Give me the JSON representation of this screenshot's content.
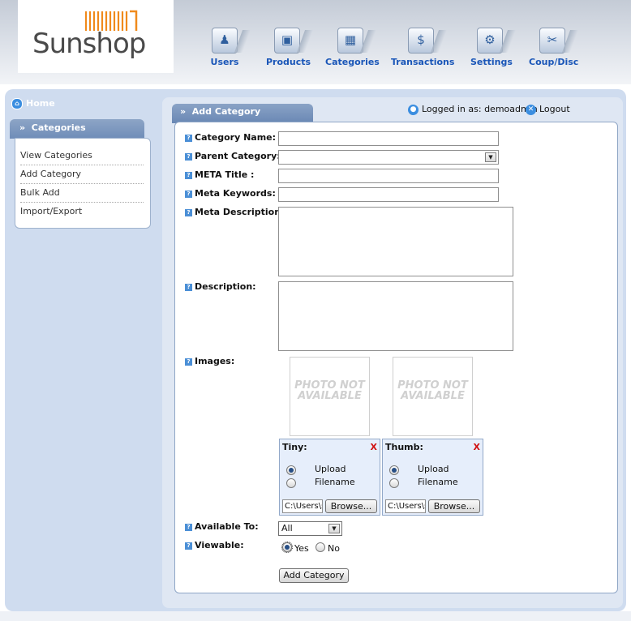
{
  "logo": {
    "text": "Sunshop"
  },
  "nav": [
    {
      "label": "Users",
      "icon": "users-icon"
    },
    {
      "label": "Products",
      "icon": "products-icon"
    },
    {
      "label": "Categories",
      "icon": "categories-icon"
    },
    {
      "label": "Transactions",
      "icon": "transactions-icon"
    },
    {
      "label": "Settings",
      "icon": "settings-icon"
    },
    {
      "label": "Coup/Disc",
      "icon": "coupon-icon"
    }
  ],
  "sidebar": {
    "home": "Home",
    "section": "Categories",
    "items": [
      "View Categories",
      "Add Category",
      "Bulk Add",
      "Import/Export"
    ]
  },
  "content": {
    "tab": "Add Category",
    "logged_in": "Logged in as: demoadmin",
    "logout": "Logout"
  },
  "form": {
    "category_name": {
      "label": "Category Name:",
      "value": ""
    },
    "parent_category": {
      "label": "Parent Category:",
      "value": ""
    },
    "meta_title": {
      "label": "META Title :",
      "value": ""
    },
    "meta_keywords": {
      "label": "Meta Keywords:",
      "value": ""
    },
    "meta_description": {
      "label": "Meta Description:",
      "value": ""
    },
    "description": {
      "label": "Description:",
      "value": ""
    },
    "images": {
      "label": "Images:",
      "placeholder": "PHOTO NOT AVAILABLE",
      "tiny": {
        "title": "Tiny:",
        "remove": "X",
        "upload": "Upload",
        "filename": "Filename",
        "path": "C:\\Users\\s",
        "browse": "Browse...",
        "selected": "upload"
      },
      "thumb": {
        "title": "Thumb:",
        "remove": "X",
        "upload": "Upload",
        "filename": "Filename",
        "path": "C:\\Users\\s",
        "browse": "Browse...",
        "selected": "upload"
      }
    },
    "available_to": {
      "label": "Available To:",
      "value": "All"
    },
    "viewable": {
      "label": "Viewable:",
      "yes": "Yes",
      "no": "No",
      "selected": "yes"
    },
    "submit": "Add Category"
  },
  "colors": {
    "nav_label": "#1a56b8",
    "panel_bg": "#cfdcef",
    "tab": "#7894bd",
    "logo_orange": "#f08a1c"
  }
}
